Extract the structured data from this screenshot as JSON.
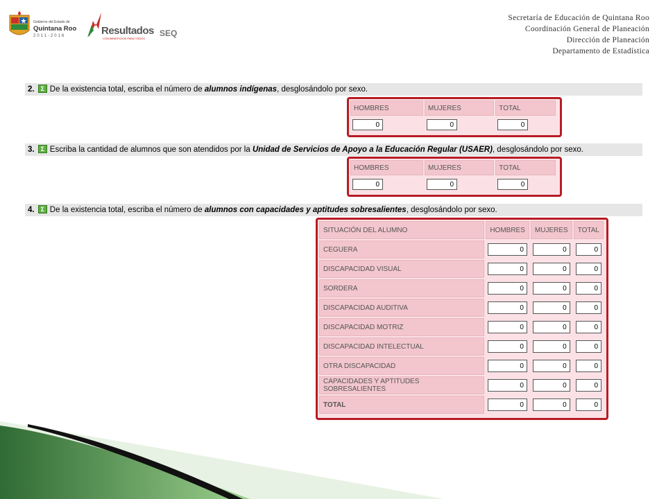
{
  "header": {
    "gov_small": "Gobierno del Estado de",
    "gov_name": "Quintana Roo",
    "gov_years": "2011-2016",
    "resultados": "Resultados",
    "resultados_sub": "CON BENEFICIOS PARA TODOS",
    "seq": "SEQ",
    "lines": [
      "Secretaría de Educación de Quintana Roo",
      "Coordinación General de Planeación",
      "Dirección de Planeación",
      "Departamento de Estadística"
    ]
  },
  "icons": {
    "sigma": "Σ"
  },
  "q2": {
    "num": "2.",
    "pre": "De la existencia total, escriba el número de ",
    "em": "alumnos indígenas",
    "post": ", desglosándolo por sexo.",
    "headers": [
      "HOMBRES",
      "MUJERES",
      "TOTAL"
    ],
    "values": [
      "0",
      "0",
      "0"
    ]
  },
  "q3": {
    "num": "3.",
    "pre": "Escriba la cantidad de alumnos que son atendidos por la ",
    "em": "Unidad de Servicios de Apoyo a la Educación Regular (USAER)",
    "post": ", desglosándolo por sexo.",
    "headers": [
      "HOMBRES",
      "MUJERES",
      "TOTAL"
    ],
    "values": [
      "0",
      "0",
      "0"
    ]
  },
  "q4": {
    "num": "4.",
    "pre": "De la existencia total, escriba el número de ",
    "em": "alumnos con capacidades y aptitudes sobresalientes",
    "post": ", desglosándolo por sexo.",
    "headers": [
      "SITUACIÓN DEL ALUMNO",
      "HOMBRES",
      "MUJERES",
      "TOTAL"
    ],
    "rows": [
      {
        "label": "CEGUERA",
        "values": [
          "0",
          "0",
          "0"
        ]
      },
      {
        "label": "DISCAPACIDAD VISUAL",
        "values": [
          "0",
          "0",
          "0"
        ]
      },
      {
        "label": "SORDERA",
        "values": [
          "0",
          "0",
          "0"
        ]
      },
      {
        "label": "DISCAPACIDAD AUDITIVA",
        "values": [
          "0",
          "0",
          "0"
        ]
      },
      {
        "label": "DISCAPACIDAD MOTRIZ",
        "values": [
          "0",
          "0",
          "0"
        ]
      },
      {
        "label": "DISCAPACIDAD INTELECTUAL",
        "values": [
          "0",
          "0",
          "0"
        ]
      },
      {
        "label": "OTRA DISCAPACIDAD",
        "values": [
          "0",
          "0",
          "0"
        ]
      },
      {
        "label": "CAPACIDADES Y APTITUDES SOBRESALIENTES",
        "values": [
          "0",
          "0",
          "0"
        ]
      },
      {
        "label": "TOTAL",
        "values": [
          "0",
          "0",
          "0"
        ]
      }
    ]
  },
  "colors": {
    "frame_border": "#b71c24",
    "frame_fill": "#fbe1e5",
    "header_cell": "#f2c6cc",
    "sigma_icon": "#5fae3f",
    "green_dark": "#2f6b34",
    "green_light": "#9ccf8c"
  }
}
